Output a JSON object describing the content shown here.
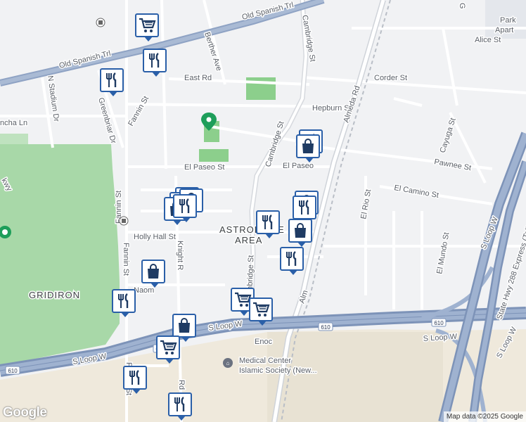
{
  "map": {
    "area_label": [
      "ASTRODOME",
      "AREA"
    ],
    "district_label": "GRIDIRON",
    "streets": {
      "old_spanish_trl_upper": "Old Spanish Trl",
      "old_spanish_trl_lower": "Old Spanish Trl",
      "berther_ave": "Berther Ave",
      "cambridge_st_upper": "Cambridge St",
      "cambridge_st_mid": "Cambridge St",
      "cambridge_st_lower": "Cambridge St",
      "east_rd": "East Rd",
      "hepburn_st": "Hepburn St",
      "corder_st": "Corder St",
      "alice_st": "Alice St",
      "almeda_rd": "Almeda Rd",
      "n_stadium_dr": "N Stadium Dr",
      "greenbriar_dr": "Greenbriar Dr",
      "fannin_st_upper": "Fannin St",
      "fannin_st_mid": "Fannin St",
      "fannin_st_lower": "Fannin St",
      "el_paseo_st_left": "El Paseo St",
      "el_paseo_st_right": "El Paseo",
      "holly_hall_st": "Holly Hall St",
      "knight_rd_upper": "Knight R",
      "knight_rd_lower": "Rd",
      "naomi": "Naom",
      "cayuga_st": "Cayuga St",
      "pawnee_st": "Pawnee St",
      "el_camino_st": "El Camino St",
      "el_rio_st": "El Rio St",
      "el_mundo_st": "El Mundo St",
      "s_loop_w_left": "S Loop W",
      "s_loop_w_mid": "S Loop W",
      "s_loop_w_right": "S Loop W",
      "s_loop_w_upper_right": "S Loop W",
      "s_loop_w_far_right": "S Loop W",
      "state_hwy_288": "State Hwy 288 Express (Toll road)",
      "ancha_ln": "ncha Ln",
      "pkwy": "kwy",
      "enoch": "Enoc",
      "almeda_short": "Alm",
      "park_apart": [
        "Park",
        "Apart"
      ],
      "g_top_right": "G"
    },
    "highway_shields": [
      "610",
      "610",
      "610",
      "610"
    ],
    "pois": {
      "medical_center": [
        "Medical Center",
        "Islamic Society (New..."
      ]
    },
    "markers": [
      {
        "icon": "shopping-cart-icon"
      },
      {
        "icon": "restaurant-icon"
      },
      {
        "icon": "restaurant-icon"
      },
      {
        "icon": "restaurant-icon"
      },
      {
        "icon": "shopping-bag-icon"
      },
      {
        "icon": "shopping-cart-icon"
      },
      {
        "icon": "shopping-cart-icon"
      },
      {
        "icon": "shopping-bag-icon"
      },
      {
        "icon": "shopping-bag-icon"
      },
      {
        "icon": "restaurant-icon"
      },
      {
        "icon": "shopping-bag-icon"
      },
      {
        "icon": "restaurant-icon"
      },
      {
        "icon": "shopping-bag-icon"
      },
      {
        "icon": "restaurant-icon"
      },
      {
        "icon": "shopping-bag-icon"
      },
      {
        "icon": "restaurant-icon"
      },
      {
        "icon": "shopping-cart-icon"
      },
      {
        "icon": "shopping-cart-icon"
      },
      {
        "icon": "shopping-bag-icon"
      }
    ],
    "colors": {
      "marker_border": "#2a5fa8",
      "marker_icon": "#1f3b63",
      "highway": "#8fa3c4",
      "park": "#9ccc9c",
      "gridiron_park": "#a8d8a8",
      "background": "#f1f2f4"
    }
  },
  "footer": {
    "logo": "Google",
    "credit": "Map data ©2025 Google"
  }
}
